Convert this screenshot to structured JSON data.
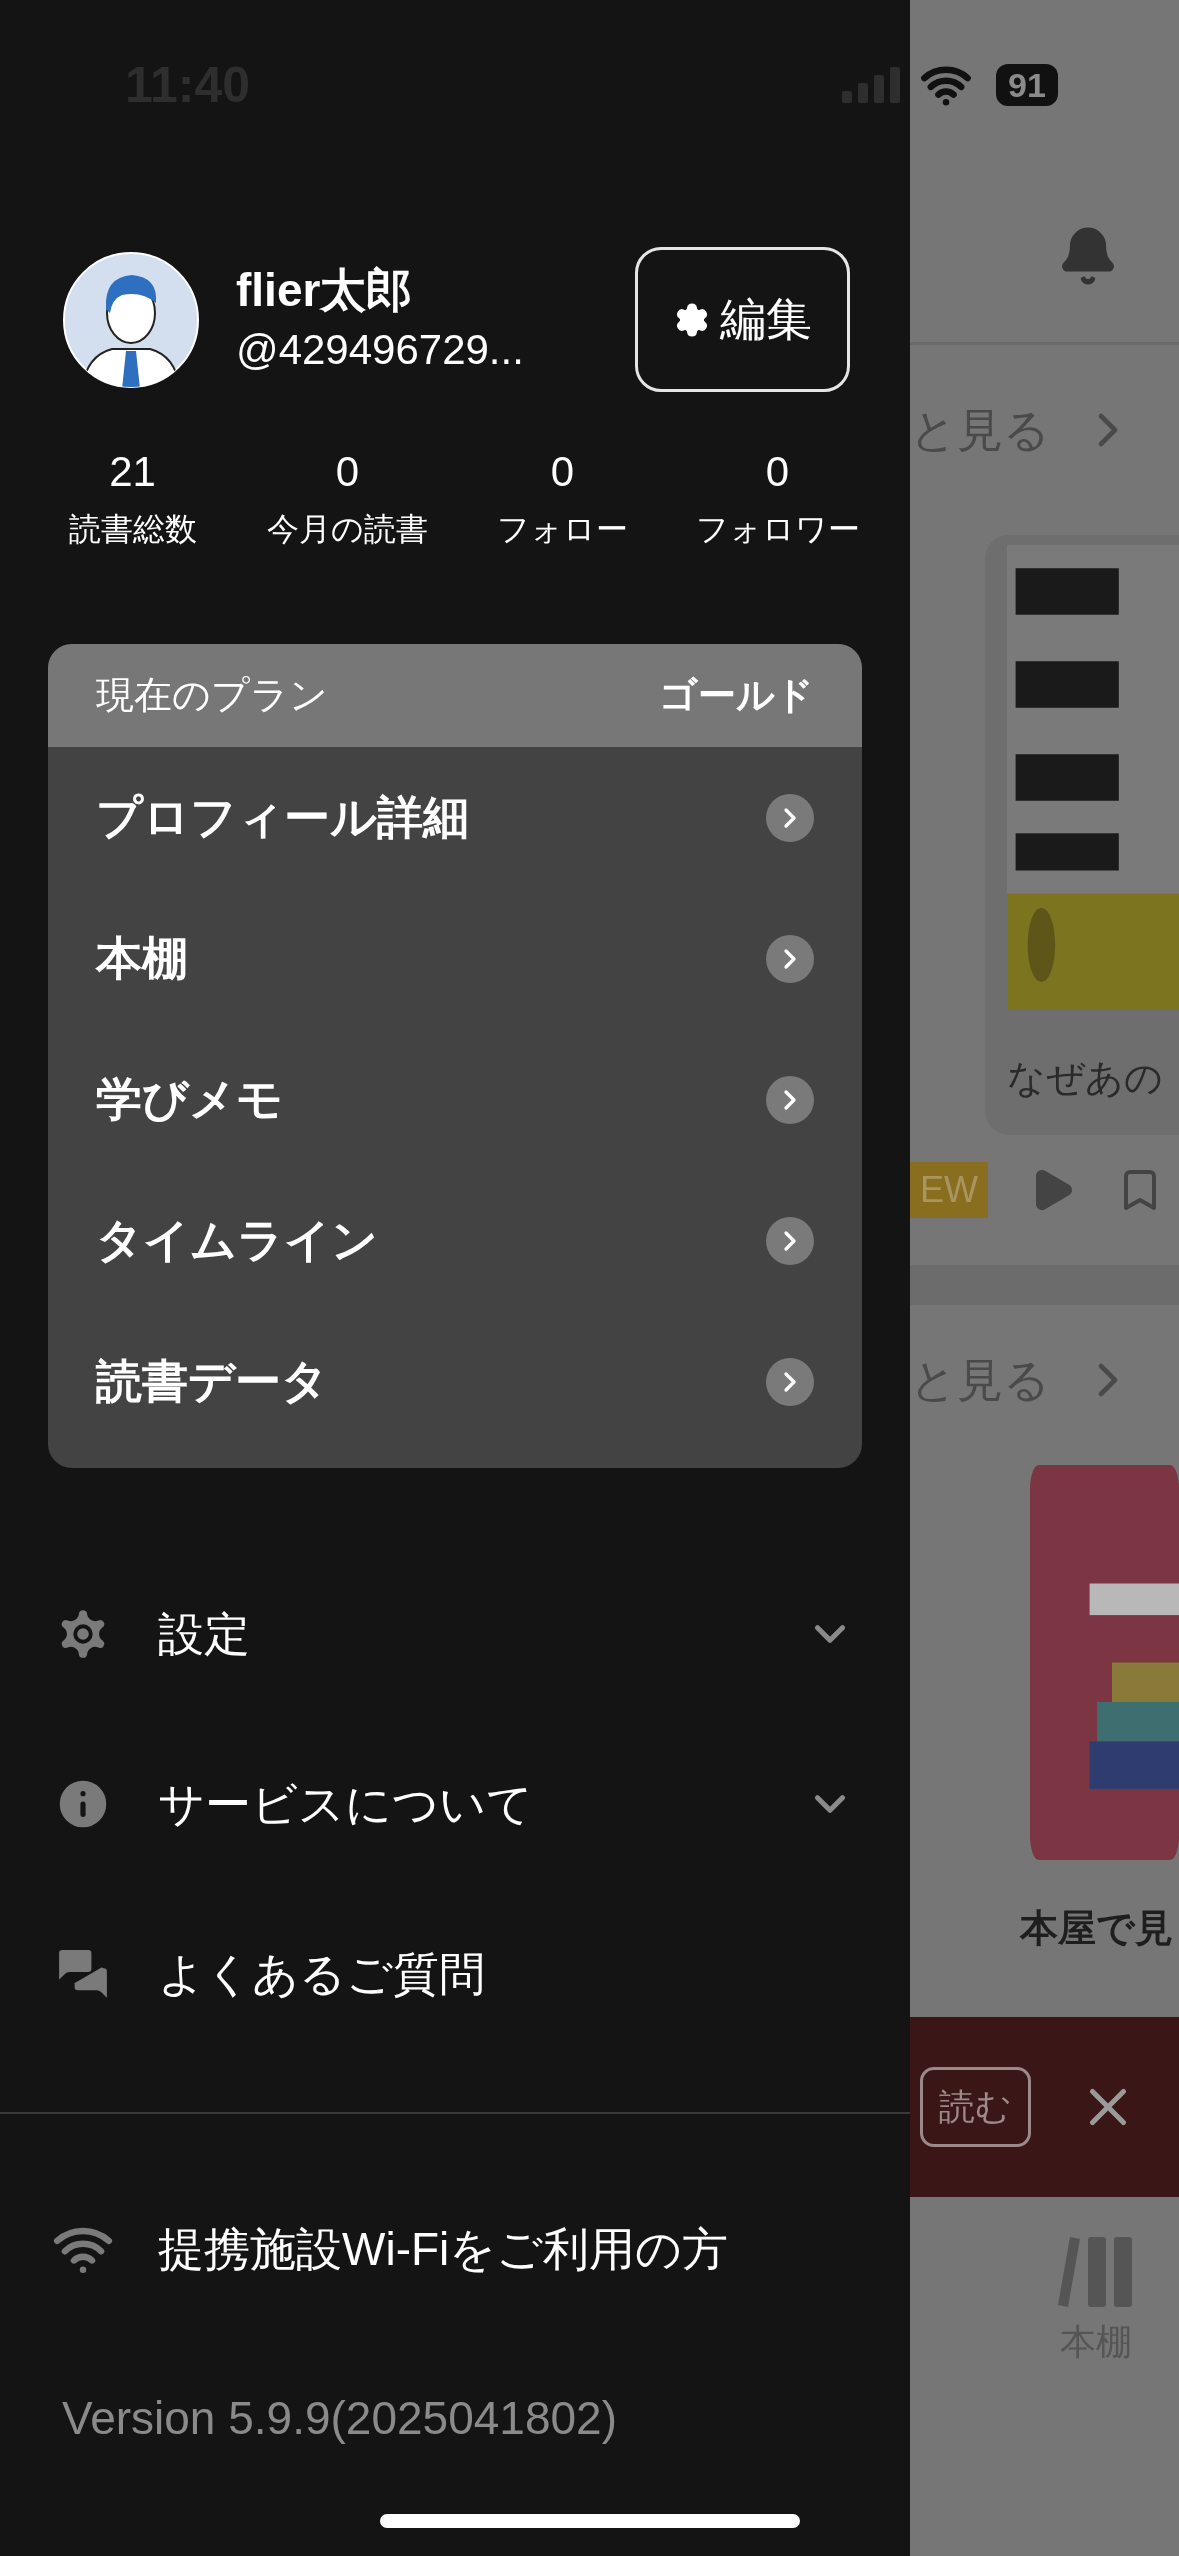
{
  "status_bar": {
    "time": "11:40",
    "battery": "91"
  },
  "profile": {
    "name": "flier太郎",
    "handle": "@429496729...",
    "edit_button": "編集"
  },
  "stats": [
    {
      "value": "21",
      "label": "読書総数"
    },
    {
      "value": "0",
      "label": "今月の読書"
    },
    {
      "value": "0",
      "label": "フォロー"
    },
    {
      "value": "0",
      "label": "フォロワー"
    }
  ],
  "plan": {
    "label": "現在のプラン",
    "value": "ゴールド",
    "items": [
      "プロフィール詳細",
      "本棚",
      "学びメモ",
      "タイムライン",
      "読書データ"
    ]
  },
  "menu": [
    {
      "kind": "settings",
      "label": "設定",
      "expandable": true
    },
    {
      "kind": "info",
      "label": "サービスについて",
      "expandable": true
    },
    {
      "kind": "faq",
      "label": "よくあるご質問",
      "expandable": false
    }
  ],
  "wifi_link": "提携施設Wi-Fiをご利用の方",
  "version": "Version 5.9.9(2025041802)",
  "background": {
    "see_more": [
      "と見る",
      "と見る"
    ],
    "book_caption": "なぜあの",
    "badge": "EW",
    "feature_caption": "本屋で見",
    "read_button": "読む",
    "tab": "本棚"
  }
}
